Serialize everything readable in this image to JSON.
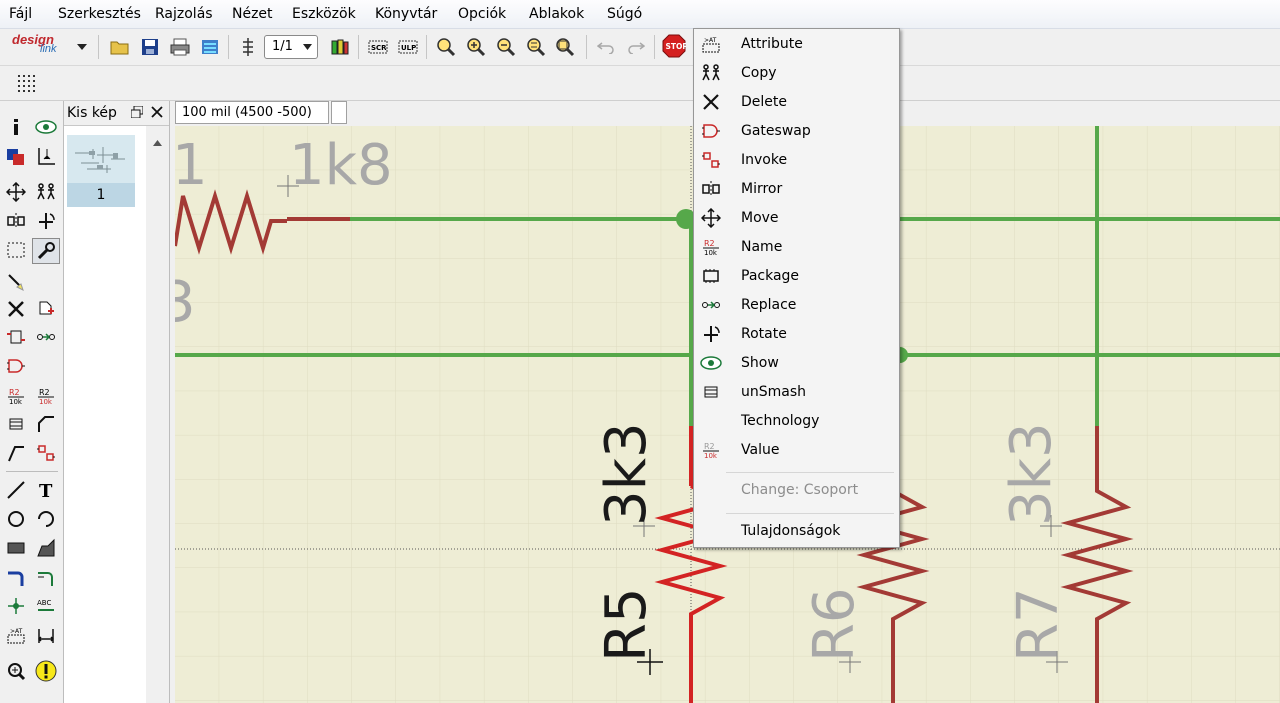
{
  "menubar": {
    "items": [
      "Fájl",
      "Szerkesztés",
      "Rajzolás",
      "Nézet",
      "Eszközök",
      "Könyvtár",
      "Opciók",
      "Ablakok",
      "Súgó"
    ]
  },
  "toolbar": {
    "logo_line1": "design",
    "logo_line2": "link",
    "sheet_select": "1/1"
  },
  "panel": {
    "title": "Kis kép",
    "thumbnail_label": "1"
  },
  "coord_field": "100 mil (4500 -500)",
  "schematic": {
    "labels": [
      "1",
      "1k8",
      "3",
      "3k3",
      "R5",
      "R6",
      "3k3",
      "R7"
    ]
  },
  "context_menu": {
    "items": [
      {
        "label": "Attribute",
        "icon": "attribute-icon"
      },
      {
        "label": "Copy",
        "icon": "copy-icon"
      },
      {
        "label": "Delete",
        "icon": "delete-icon"
      },
      {
        "label": "Gateswap",
        "icon": "gateswap-icon"
      },
      {
        "label": "Invoke",
        "icon": "invoke-icon"
      },
      {
        "label": "Mirror",
        "icon": "mirror-icon"
      },
      {
        "label": "Move",
        "icon": "move-icon"
      },
      {
        "label": "Name",
        "icon": "name-icon"
      },
      {
        "label": "Package",
        "icon": "package-icon"
      },
      {
        "label": "Replace",
        "icon": "replace-icon"
      },
      {
        "label": "Rotate",
        "icon": "rotate-icon"
      },
      {
        "label": "Show",
        "icon": "show-icon"
      },
      {
        "label": "unSmash",
        "icon": "unsmash-icon"
      },
      {
        "label": "Technology",
        "icon": ""
      },
      {
        "label": "Value",
        "icon": "value-icon"
      }
    ],
    "change_label": "Change: Csoport",
    "properties_label": "Tulajdonságok"
  },
  "colors": {
    "canvas_bg": "#eeedd5",
    "net_green": "#56a84a",
    "resistor_red": "#a33a35",
    "text_gray": "#a8a8a8"
  }
}
